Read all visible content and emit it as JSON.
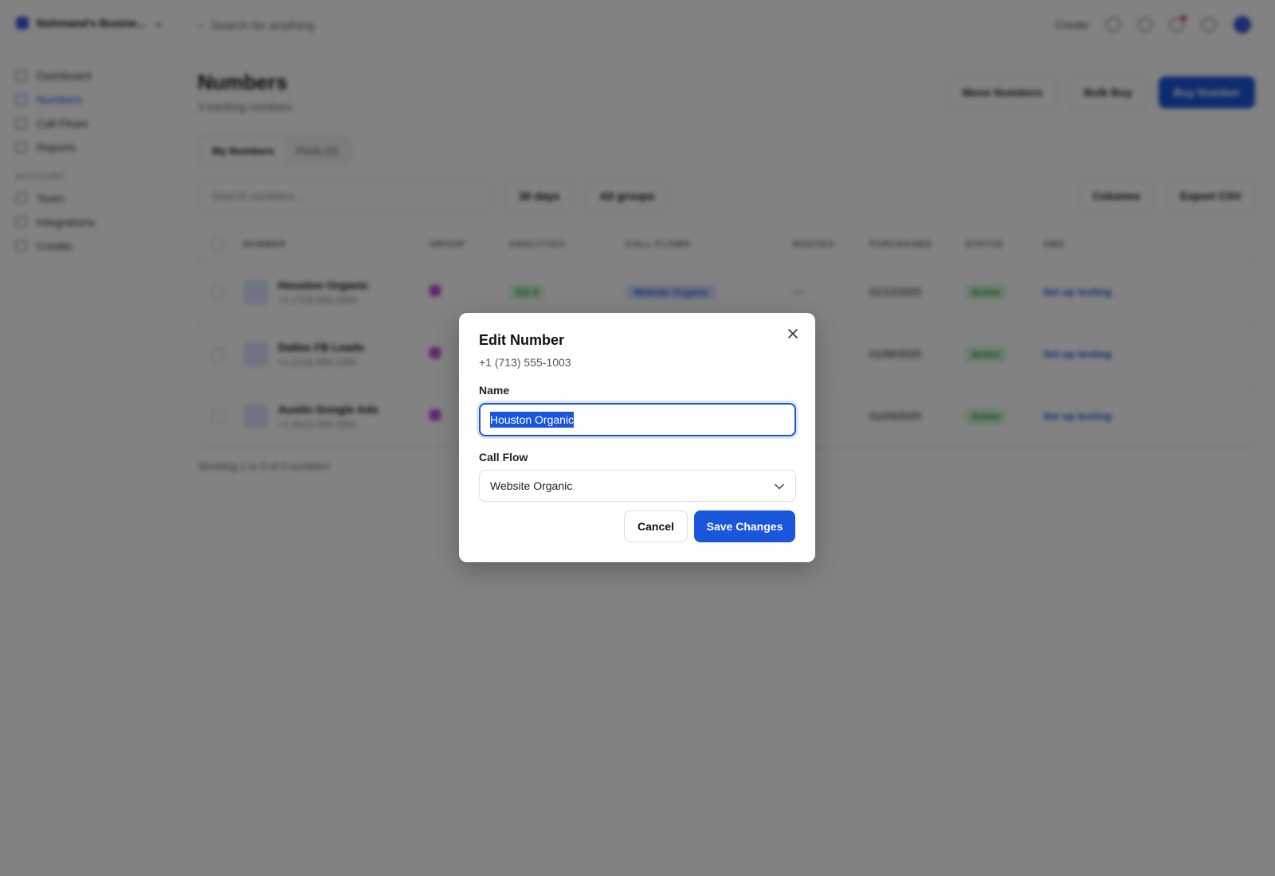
{
  "workspace": {
    "name": "Nshmand's Busine..."
  },
  "sidebar": {
    "items": [
      {
        "label": "Dashboard"
      },
      {
        "label": "Numbers"
      },
      {
        "label": "Call Flows"
      },
      {
        "label": "Reports"
      }
    ],
    "section_label": "ACCOUNT",
    "account_items": [
      {
        "label": "Team"
      },
      {
        "label": "Integrations"
      },
      {
        "label": "Credits"
      }
    ]
  },
  "topbar": {
    "search_placeholder": "Search for anything",
    "create_label": "Create"
  },
  "page": {
    "title": "Numbers",
    "subtitle": "3 tracking numbers",
    "move_button": "Move Numbers",
    "bulk_button": "Bulk Buy",
    "buy_button": "Buy Number"
  },
  "tabs": [
    {
      "label": "My Numbers"
    },
    {
      "label": "Pools (0)"
    }
  ],
  "filters": {
    "search_placeholder": "Search numbers...",
    "days": "30 days",
    "groups": "All groups",
    "columns": "Columns",
    "export": "Export CSV"
  },
  "table": {
    "headers": [
      "NUMBER",
      "GROUP",
      "ANALYTICS",
      "CALL FLOWS",
      "ROUTES",
      "PURCHASED",
      "STATUS",
      "SMS"
    ],
    "rows": [
      {
        "name": "Houston Organic",
        "phone": "+1 (713) 555-1003",
        "analytics": "GA 4",
        "flow": "Website Organic",
        "routes": "—",
        "purchased": "01/12/2025",
        "status": "Active",
        "sms": "Set up texting"
      },
      {
        "name": "Dallas FB Leads",
        "phone": "+1 (214) 555-1002",
        "analytics": "",
        "flow": "",
        "routes": "",
        "purchased": "01/08/2025",
        "status": "Active",
        "sms": "Set up texting"
      },
      {
        "name": "Austin Google Ads",
        "phone": "+1 (512) 555-1001",
        "analytics": "",
        "flow": "",
        "routes": "",
        "purchased": "01/03/2025",
        "status": "Active",
        "sms": "Set up texting"
      }
    ],
    "footer": "Showing 1 to 3 of 3 numbers"
  },
  "modal": {
    "title": "Edit Number",
    "subtitle": "+1 (713) 555-1003",
    "name_label": "Name",
    "name_value": "Houston Organic",
    "flow_label": "Call Flow",
    "flow_value": "Website Organic",
    "cancel_label": "Cancel",
    "save_label": "Save Changes"
  },
  "colors": {
    "accent": "#1a56db",
    "overlay": "rgba(0,0,0,0.49)"
  }
}
